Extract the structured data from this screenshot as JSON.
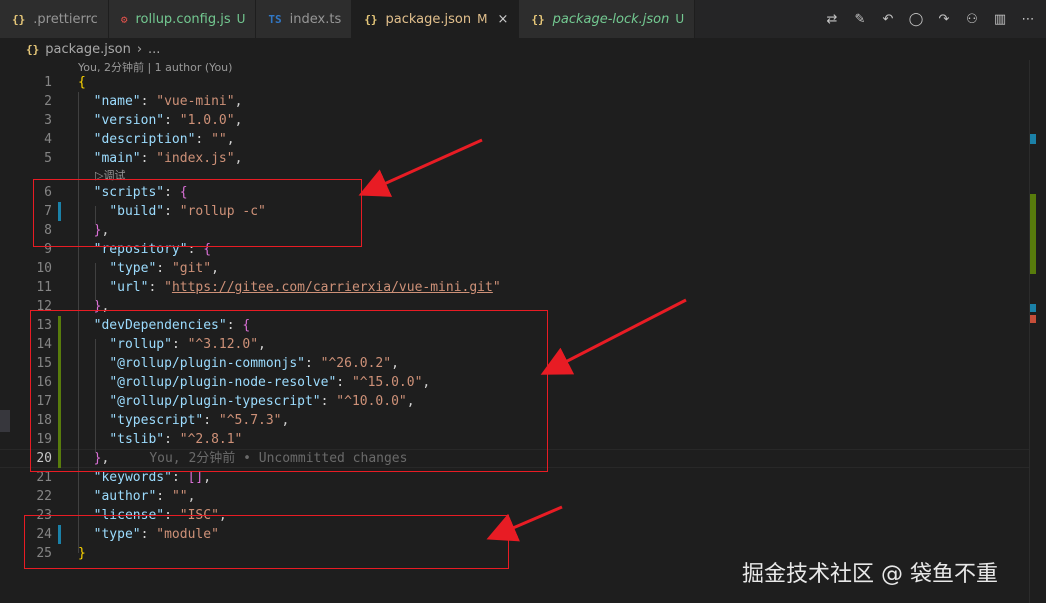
{
  "tabs": [
    {
      "icon": "{}",
      "name": ".prettierrc",
      "badge": "",
      "color": "#969696"
    },
    {
      "icon": "⚙",
      "name": "rollup.config.js",
      "badge": "U",
      "color": "#73c991"
    },
    {
      "icon": "TS",
      "name": "index.ts",
      "badge": "",
      "color": "#969696"
    },
    {
      "icon": "{}",
      "name": "package.json",
      "badge": "M",
      "color": "#e2c08d",
      "active": true,
      "close": "×"
    },
    {
      "icon": "{}",
      "name": "package-lock.json",
      "badge": "U",
      "color": "#73c991"
    }
  ],
  "breadcrumb": {
    "file": "package.json",
    "rest": "..."
  },
  "codelens": {
    "blame": "You, 2分钟前 | 1 author (You)",
    "debug": "▷调试"
  },
  "lines": [
    {
      "n": "1"
    },
    {
      "n": "2"
    },
    {
      "n": "3"
    },
    {
      "n": "4"
    },
    {
      "n": "5"
    },
    {
      "n": "6"
    },
    {
      "n": "7"
    },
    {
      "n": "8"
    },
    {
      "n": "9"
    },
    {
      "n": "10"
    },
    {
      "n": "11"
    },
    {
      "n": "12"
    },
    {
      "n": "13"
    },
    {
      "n": "14"
    },
    {
      "n": "15"
    },
    {
      "n": "16"
    },
    {
      "n": "17"
    },
    {
      "n": "18"
    },
    {
      "n": "19"
    },
    {
      "n": "20"
    },
    {
      "n": "21"
    },
    {
      "n": "22"
    },
    {
      "n": "23"
    },
    {
      "n": "24"
    },
    {
      "n": "25"
    }
  ],
  "pkg": {
    "name_key": "\"name\"",
    "name_val": "\"vue-mini\"",
    "version_key": "\"version\"",
    "version_val": "\"1.0.0\"",
    "description_key": "\"description\"",
    "description_val": "\"\"",
    "main_key": "\"main\"",
    "main_val": "\"index.js\"",
    "scripts_key": "\"scripts\"",
    "build_key": "\"build\"",
    "build_val": "\"rollup -c\"",
    "repository_key": "\"repository\"",
    "type_key": "\"type\"",
    "type_val": "\"git\"",
    "url_key": "\"url\"",
    "url_q": "\"",
    "url_val": "https://gitee.com/carrierxia/vue-mini.git",
    "devdeps_key": "\"devDependencies\"",
    "rollup_key": "\"rollup\"",
    "rollup_val": "\"^3.12.0\"",
    "commonjs_key": "\"@rollup/plugin-commonjs\"",
    "commonjs_val": "\"^26.0.2\"",
    "resolve_key": "\"@rollup/plugin-node-resolve\"",
    "resolve_val": "\"^15.0.0\"",
    "ts_plugin_key": "\"@rollup/plugin-typescript\"",
    "ts_plugin_val": "\"^10.0.0\"",
    "typescript_key": "\"typescript\"",
    "typescript_val": "\"^5.7.3\"",
    "tslib_key": "\"tslib\"",
    "tslib_val": "\"^2.8.1\"",
    "keywords_key": "\"keywords\"",
    "author_key": "\"author\"",
    "author_val": "\"\"",
    "license_key": "\"license\"",
    "license_val": "\"ISC\"",
    "mtype_key": "\"type\"",
    "mtype_val": "\"module\""
  },
  "inline_blame": "You, 2分钟前 • Uncommitted changes",
  "watermark": "掘金技术社区 @ 袋鱼不重",
  "colors": {
    "accent_red": "#e81c24",
    "modified": "#1b81a8",
    "added": "#587c0c"
  }
}
